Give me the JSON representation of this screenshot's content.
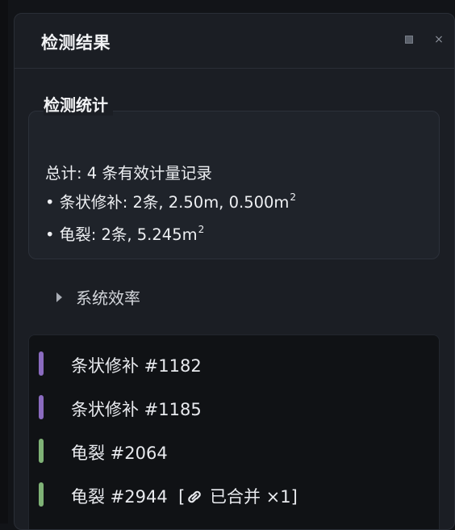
{
  "panel": {
    "title": "检测结果",
    "restore_icon": "restore-icon",
    "close_glyph": "×"
  },
  "stats": {
    "section_title": "检测统计",
    "total_line": "总计: 4 条有效计量记录",
    "line_strip": "• 条状修补: 2条, 2.50m, 0.500m",
    "line_strip_unit_sup": "2",
    "line_crack": "• 龟裂: 2条, 5.245m",
    "line_crack_unit_sup": "2"
  },
  "efficiency": {
    "label": "系统效率",
    "expanded": false
  },
  "list": {
    "items": [
      {
        "label": "条状修补 #1182",
        "color": "#8a6bbf"
      },
      {
        "label": "条状修补 #1185",
        "color": "#8a6bbf"
      },
      {
        "label": "龟裂 #2064",
        "color": "#7fb276"
      },
      {
        "label": "龟裂 #2944",
        "color": "#7fb276",
        "merge_open": "[",
        "merge_icon": "link-icon",
        "merge_text": "已合并 ×1]"
      }
    ]
  }
}
